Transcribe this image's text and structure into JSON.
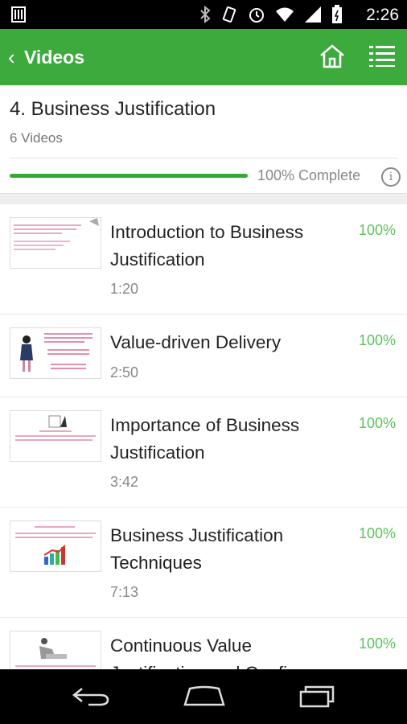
{
  "status_bar": {
    "time": "2:26",
    "icons": [
      "sim-icon",
      "bluetooth-icon",
      "vibrate-icon",
      "alarm-icon",
      "wifi-icon",
      "signal-icon",
      "battery-icon"
    ]
  },
  "app_bar": {
    "back_glyph": "‹",
    "title": "Videos",
    "icons": [
      "home-icon",
      "list-menu-icon"
    ],
    "color": "#3daa3d"
  },
  "module": {
    "title": "4. Business Justification",
    "count": "6 Videos",
    "progress_text": "100% Complete",
    "progress_value": 1.0,
    "info_glyph": "i"
  },
  "videos": [
    {
      "title_line1": "Introduction to Business",
      "title_line2": "Justification",
      "duration": "1:20",
      "percent": "100%"
    },
    {
      "title_line1": "Value-driven Delivery",
      "title_line2": "",
      "duration": "2:50",
      "percent": "100%"
    },
    {
      "title_line1": "Importance of Business",
      "title_line2": "Justification",
      "duration": "3:42",
      "percent": "100%"
    },
    {
      "title_line1": "Business Justification",
      "title_line2": "Techniques",
      "duration": "7:13",
      "percent": "100%"
    },
    {
      "title_line1": "Continuous Value",
      "title_line2": "Justification and Confirm",
      "duration": "",
      "percent": "100%"
    }
  ],
  "nav_bar": {
    "icons": [
      "back-icon",
      "home-icon",
      "recent-apps-icon"
    ]
  }
}
